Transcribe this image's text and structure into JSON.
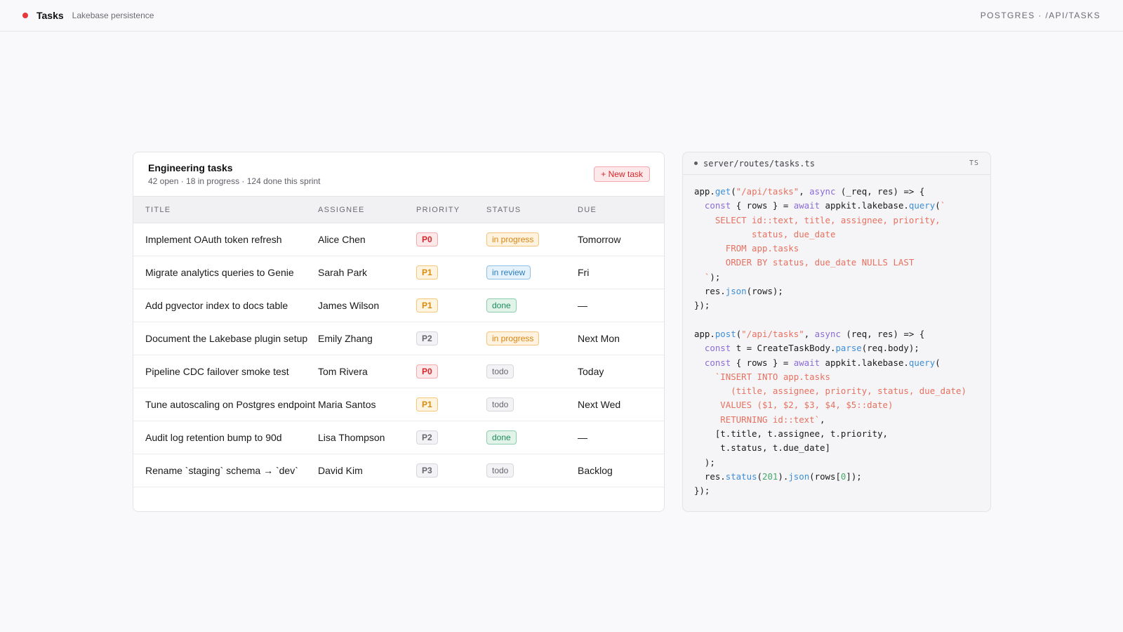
{
  "header": {
    "title": "Tasks",
    "subtitle": "Lakebase persistence",
    "right_label": "POSTGRES · /API/TASKS"
  },
  "tasks": {
    "title": "Engineering tasks",
    "summary": "42 open · 18 in progress · 124 done this sprint",
    "new_button": "+ New task",
    "columns": [
      "TITLE",
      "ASSIGNEE",
      "PRIORITY",
      "STATUS",
      "DUE"
    ],
    "rows": [
      {
        "title": "Implement OAuth token refresh",
        "assignee": "Alice Chen",
        "priority": "P0",
        "status": "in progress",
        "due": "Tomorrow"
      },
      {
        "title": "Migrate analytics queries to Genie",
        "assignee": "Sarah Park",
        "priority": "P1",
        "status": "in review",
        "due": "Fri"
      },
      {
        "title": "Add pgvector index to docs table",
        "assignee": "James Wilson",
        "priority": "P1",
        "status": "done",
        "due": "—"
      },
      {
        "title": "Document the Lakebase plugin setup",
        "assignee": "Emily Zhang",
        "priority": "P2",
        "status": "in progress",
        "due": "Next Mon"
      },
      {
        "title": "Pipeline CDC failover smoke test",
        "assignee": "Tom Rivera",
        "priority": "P0",
        "status": "todo",
        "due": "Today"
      },
      {
        "title": "Tune autoscaling on Postgres endpoint",
        "assignee": "Maria Santos",
        "priority": "P1",
        "status": "todo",
        "due": "Next Wed"
      },
      {
        "title": "Audit log retention bump to 90d",
        "assignee": "Lisa Thompson",
        "priority": "P2",
        "status": "done",
        "due": "—"
      },
      {
        "title": "Rename `staging` schema → `dev`",
        "assignee": "David Kim",
        "priority": "P3",
        "status": "todo",
        "due": "Backlog"
      }
    ]
  },
  "code": {
    "filename": "server/routes/tasks.ts",
    "lang": "TS",
    "lines": [
      [
        [
          "",
          "app."
        ],
        [
          "f",
          "get"
        ],
        [
          "",
          "("
        ],
        [
          "s",
          "\"/api/tasks\""
        ],
        [
          "",
          ", "
        ],
        [
          "k",
          "async"
        ],
        [
          "",
          " (_req, res) => {"
        ]
      ],
      [
        [
          "",
          "  "
        ],
        [
          "k",
          "const"
        ],
        [
          "",
          " { rows } = "
        ],
        [
          "k",
          "await"
        ],
        [
          "",
          " appkit.lakebase."
        ],
        [
          "f",
          "query"
        ],
        [
          "",
          "("
        ],
        [
          "s",
          "`"
        ]
      ],
      [
        [
          "s",
          "    SELECT id::text, title, assignee, priority,"
        ]
      ],
      [
        [
          "s",
          "           status, due_date"
        ]
      ],
      [
        [
          "s",
          "      FROM app.tasks"
        ]
      ],
      [
        [
          "s",
          "      ORDER BY status, due_date NULLS LAST"
        ]
      ],
      [
        [
          "",
          "  "
        ],
        [
          "s",
          "`"
        ],
        [
          "",
          ");"
        ]
      ],
      [
        [
          "",
          "  res."
        ],
        [
          "f",
          "json"
        ],
        [
          "",
          "(rows);"
        ]
      ],
      [
        [
          "",
          "});"
        ]
      ],
      [
        [
          "",
          ""
        ]
      ],
      [
        [
          "",
          "app."
        ],
        [
          "f",
          "post"
        ],
        [
          "",
          "("
        ],
        [
          "s",
          "\"/api/tasks\""
        ],
        [
          "",
          ", "
        ],
        [
          "k",
          "async"
        ],
        [
          "",
          " (req, res) => {"
        ]
      ],
      [
        [
          "",
          "  "
        ],
        [
          "k",
          "const"
        ],
        [
          "",
          " t = CreateTaskBody."
        ],
        [
          "f",
          "parse"
        ],
        [
          "",
          "(req.body);"
        ]
      ],
      [
        [
          "",
          "  "
        ],
        [
          "k",
          "const"
        ],
        [
          "",
          " { rows } = "
        ],
        [
          "k",
          "await"
        ],
        [
          "",
          " appkit.lakebase."
        ],
        [
          "f",
          "query"
        ],
        [
          "",
          "("
        ]
      ],
      [
        [
          "s",
          "    `INSERT INTO app.tasks"
        ]
      ],
      [
        [
          "s",
          "       (title, assignee, priority, status, due_date)"
        ]
      ],
      [
        [
          "s",
          "     VALUES ($1, $2, $3, $4, $5::date)"
        ]
      ],
      [
        [
          "s",
          "     RETURNING id::text`"
        ],
        [
          "",
          ","
        ]
      ],
      [
        [
          "",
          "    [t.title, t.assignee, t.priority,"
        ]
      ],
      [
        [
          "",
          "     t.status, t.due_date]"
        ]
      ],
      [
        [
          "",
          "  );"
        ]
      ],
      [
        [
          "",
          "  res."
        ],
        [
          "f",
          "status"
        ],
        [
          "",
          "("
        ],
        [
          "n",
          "201"
        ],
        [
          "",
          ")."
        ],
        [
          "f",
          "json"
        ],
        [
          "",
          "(rows["
        ],
        [
          "n",
          "0"
        ],
        [
          "",
          "]);"
        ]
      ],
      [
        [
          "",
          "});"
        ]
      ]
    ]
  },
  "colors": {
    "accent": "#e5393b",
    "priority": {
      "P0": {
        "text": "#d7262b",
        "bg": "#fde9ea",
        "border": "#f2a9ab"
      },
      "P1": {
        "text": "#d88a0c",
        "bg": "#fff4e0",
        "border": "#f3c77a"
      },
      "P2": {
        "text": "#666670",
        "bg": "#f3f3f5",
        "border": "#d6d6dc"
      },
      "P3": {
        "text": "#666670",
        "bg": "#f3f3f5",
        "border": "#d6d6dc"
      }
    },
    "status": {
      "in progress": {
        "text": "#d98410",
        "bg": "#fff3df",
        "border": "#f2c47e"
      },
      "in review": {
        "text": "#2a7fc1",
        "bg": "#e5f1fb",
        "border": "#8dc0e8"
      },
      "done": {
        "text": "#1f8a5c",
        "bg": "#e2f4ea",
        "border": "#8ccdb0"
      },
      "todo": {
        "text": "#666670",
        "bg": "#f3f3f5",
        "border": "#d6d6dc"
      }
    }
  }
}
